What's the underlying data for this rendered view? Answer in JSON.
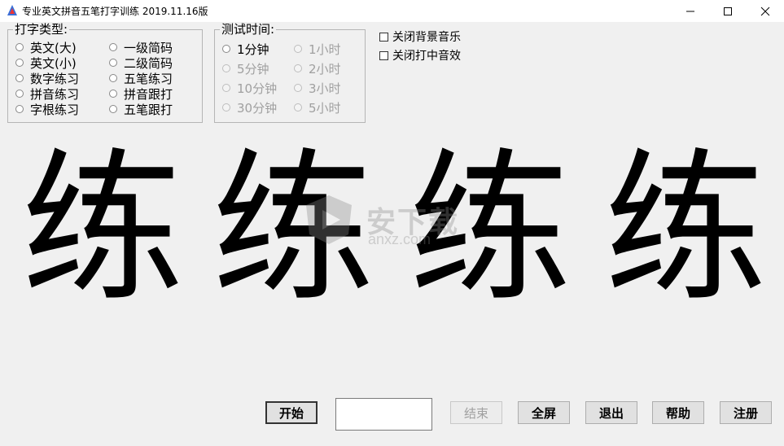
{
  "window": {
    "title": "专业英文拼音五笔打字训练  2019.11.16版",
    "minimize_glyph": "—",
    "maximize_glyph": "☐",
    "close_glyph": "✕"
  },
  "type_group": {
    "legend": "打字类型:",
    "options": [
      "英文(大)",
      "英文(小)",
      "数字练习",
      "拼音练习",
      "字根练习",
      "一级简码",
      "二级简码",
      "五笔练习",
      "拼音跟打",
      "五笔跟打"
    ]
  },
  "time_group": {
    "legend": "测试时间:",
    "options": [
      "1分钟",
      "5分钟",
      "10分钟",
      "30分钟",
      "1小时",
      "2小时",
      "3小时",
      "5小时"
    ]
  },
  "checkboxes": {
    "bg_music": "关闭背景音乐",
    "hit_sound": "关闭打中音效"
  },
  "practice_chars": [
    "练",
    "练",
    "练",
    "练"
  ],
  "watermark": {
    "text": "安下载",
    "sub": "anxz.com"
  },
  "buttons": {
    "start": "开始",
    "end": "结束",
    "fullscreen": "全屏",
    "exit": "退出",
    "help": "帮助",
    "register": "注册"
  },
  "input": {
    "value": ""
  }
}
